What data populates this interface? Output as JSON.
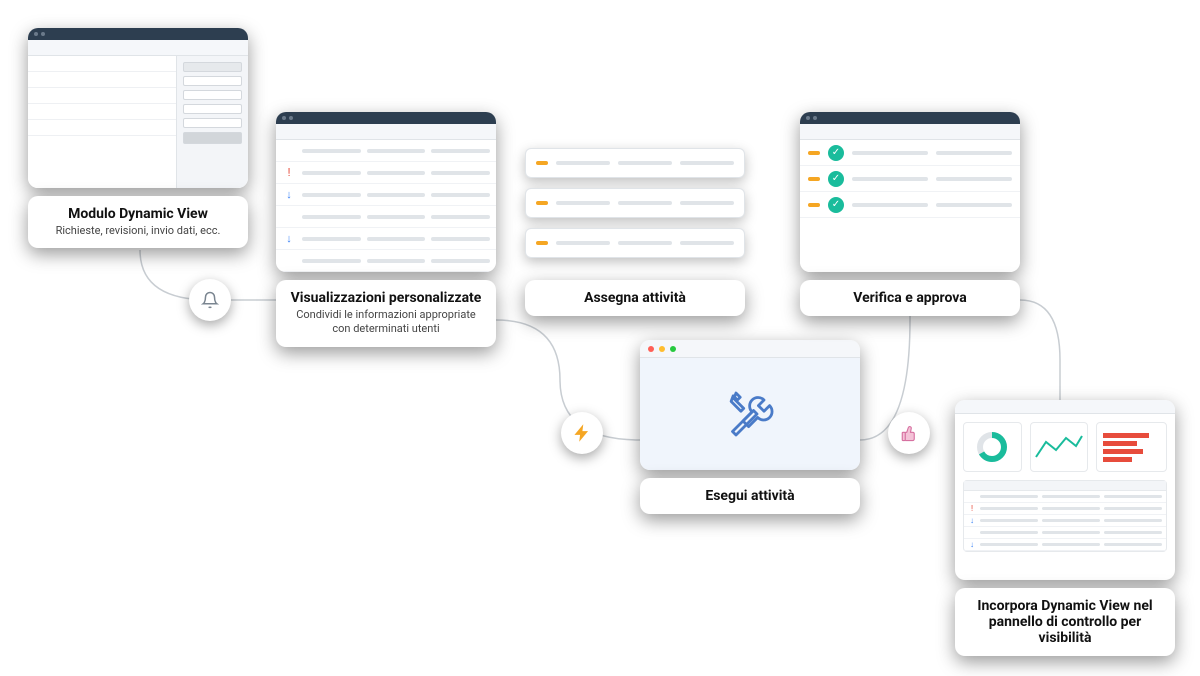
{
  "steps": {
    "module": {
      "title": "Modulo Dynamic View",
      "subtitle": "Richieste, revisioni, invio dati, ecc."
    },
    "views": {
      "title": "Visualizzazioni personalizzate",
      "subtitle": "Condividi le informazioni appropriate con determinati utenti",
      "row_icons": [
        "!",
        "↓",
        "",
        "↓",
        ""
      ]
    },
    "assign": {
      "title": "Assegna attività"
    },
    "execute": {
      "title": "Esegui attività"
    },
    "verify": {
      "title": "Verifica e approva"
    },
    "embed": {
      "title": "Incorpora Dynamic View nel pannello di controllo per visibilità"
    }
  },
  "badges": {
    "notify": "bell-icon",
    "automate": "bolt-icon",
    "approve": "thumbs-up-icon"
  },
  "colors": {
    "accent_blue": "#3b82f6",
    "accent_green": "#1abc9c",
    "accent_orange": "#f5a623",
    "accent_red": "#e74c3c"
  }
}
